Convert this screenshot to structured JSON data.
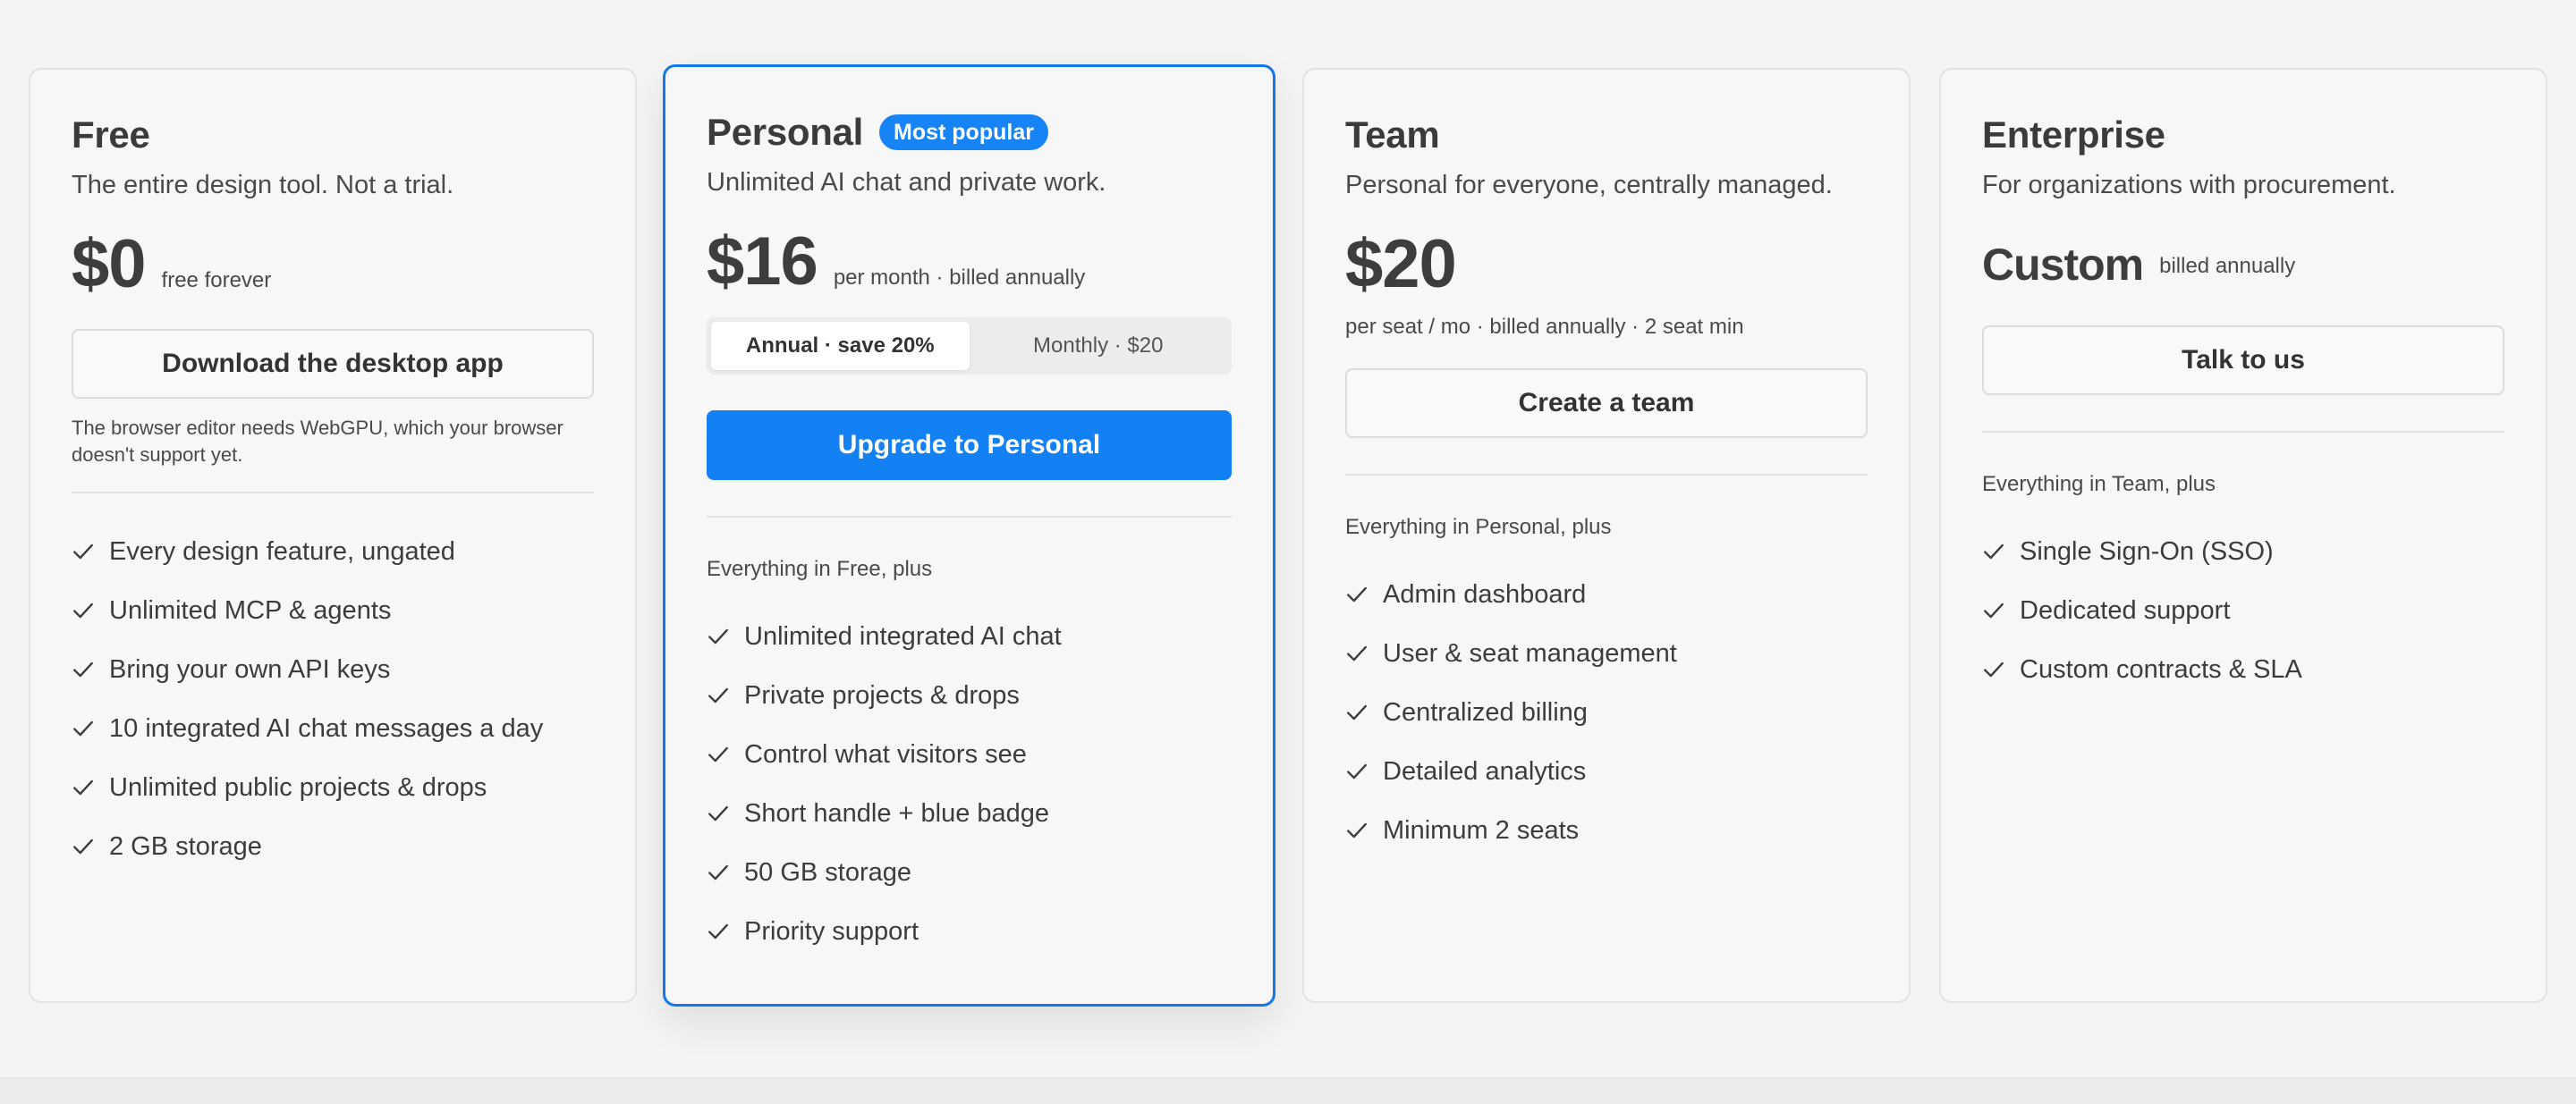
{
  "plans": [
    {
      "name": "Free",
      "tagline": "The entire design tool. Not a trial.",
      "price": "$0",
      "price_note": "free forever",
      "button_label": "Download the desktop app",
      "note": "The browser editor needs WebGPU, which your browser doesn't support yet.",
      "features": [
        "Every design feature, ungated",
        "Unlimited MCP & agents",
        "Bring your own API keys",
        "10 integrated AI chat messages a day",
        "Unlimited public projects & drops",
        "2 GB storage"
      ]
    },
    {
      "name": "Personal",
      "badge": "Most popular",
      "tagline": "Unlimited AI chat and private work.",
      "price": "$16",
      "price_note": "per month · billed annually",
      "toggle": {
        "annual": "Annual · save 20%",
        "monthly": "Monthly · $20",
        "selected": "annual"
      },
      "button_label": "Upgrade to Personal",
      "section_lead": "Everything in Free, plus",
      "features": [
        "Unlimited integrated AI chat",
        "Private projects & drops",
        "Control what visitors see",
        "Short handle + blue badge",
        "50 GB storage",
        "Priority support"
      ]
    },
    {
      "name": "Team",
      "tagline": "Personal for everyone, centrally managed.",
      "price": "$20",
      "seat_note": "per seat / mo · billed annually · 2 seat min",
      "button_label": "Create a team",
      "section_lead": "Everything in Personal, plus",
      "features": [
        "Admin dashboard",
        "User & seat management",
        "Centralized billing",
        "Detailed analytics",
        "Minimum 2 seats"
      ]
    },
    {
      "name": "Enterprise",
      "tagline": "For organizations with procurement.",
      "price": "Custom",
      "price_note": "billed annually",
      "button_label": "Talk to us",
      "section_lead": "Everything in Team, plus",
      "features": [
        "Single Sign-On (SSO)",
        "Dedicated support",
        "Custom contracts & SLA"
      ]
    }
  ],
  "colors": {
    "accent": "#1380f4",
    "featured_border": "#1577e8",
    "badge": "#1683f6",
    "background": "#f4f4f4",
    "card": "#f7f7f7"
  },
  "icons": {
    "feature_bullet": "check-icon"
  }
}
